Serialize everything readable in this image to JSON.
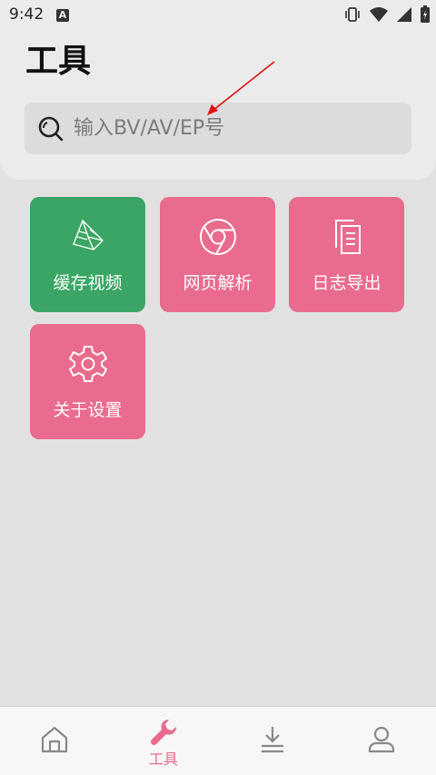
{
  "status_bar": {
    "time": "9:42",
    "notification_badge": "A"
  },
  "header": {
    "title": "工具"
  },
  "search": {
    "placeholder": "输入BV/AV/EP号",
    "value": ""
  },
  "tools": [
    {
      "label": "缓存视频",
      "icon": "zongzi-icon",
      "color": "#3aa564"
    },
    {
      "label": "网页解析",
      "icon": "chrome-browser-icon",
      "color": "#e96b8e"
    },
    {
      "label": "日志导出",
      "icon": "copy-document-icon",
      "color": "#e96b8e"
    },
    {
      "label": "关于设置",
      "icon": "gear-icon",
      "color": "#e96b8e"
    }
  ],
  "bottom_nav": {
    "items": [
      {
        "label": "",
        "icon": "home-icon"
      },
      {
        "label": "工具",
        "icon": "wrench-icon",
        "active": true
      },
      {
        "label": "",
        "icon": "download-icon"
      },
      {
        "label": "",
        "icon": "person-icon"
      }
    ],
    "active_color": "#e96b8e",
    "inactive_color": "#888888"
  }
}
